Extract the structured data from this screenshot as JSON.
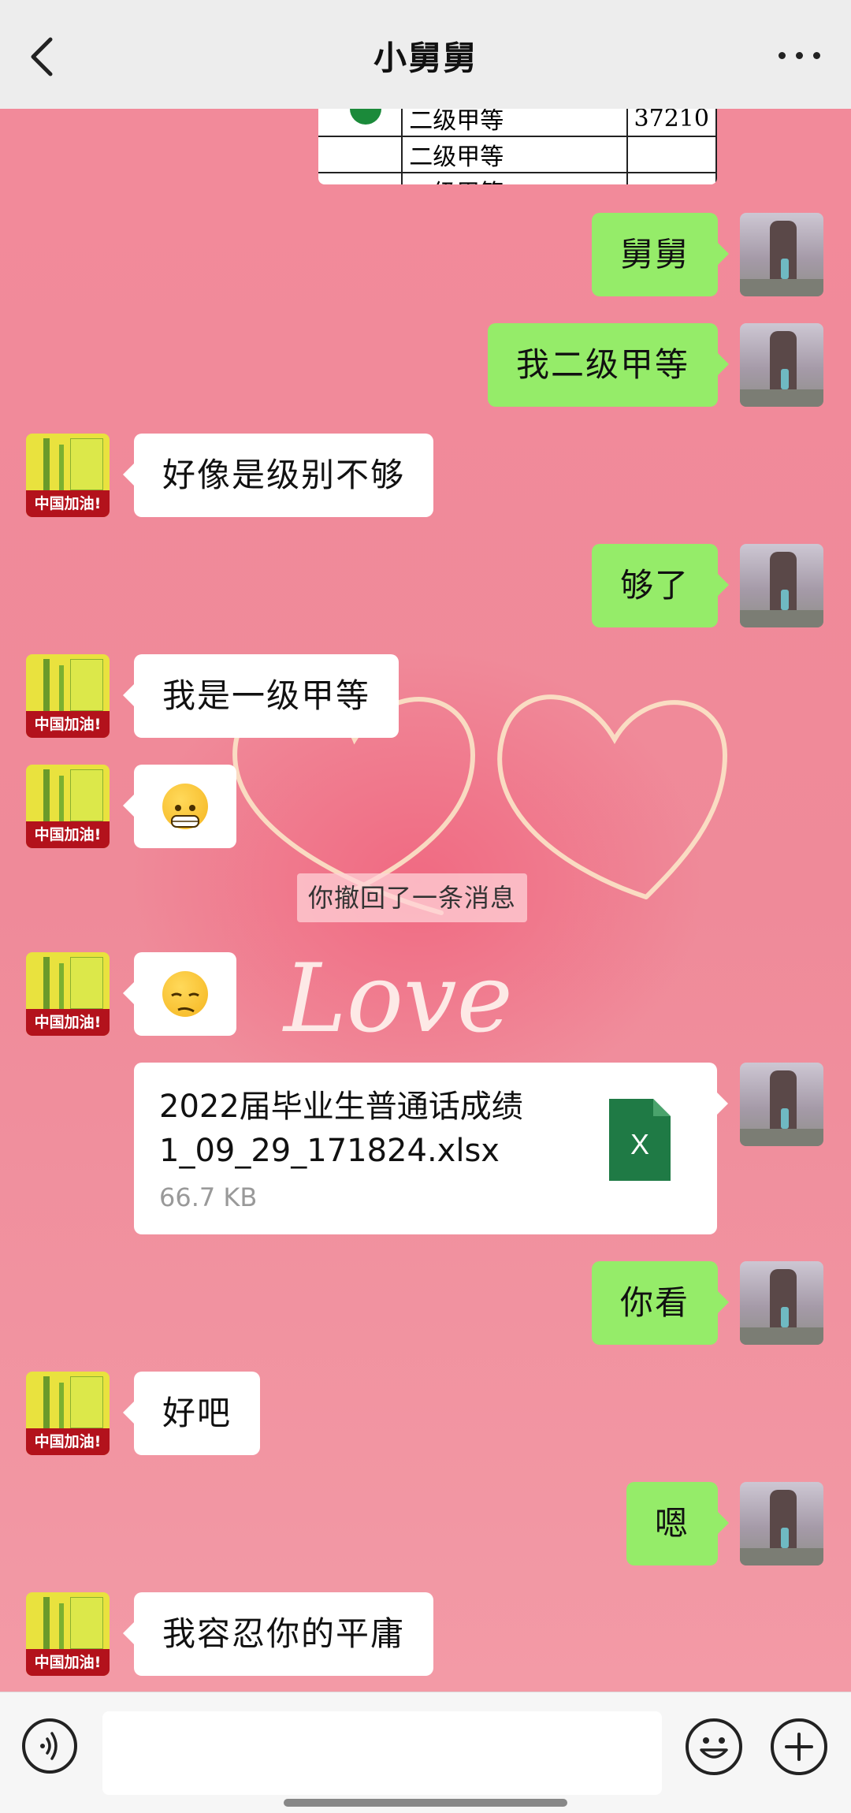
{
  "header": {
    "title": "小舅舅"
  },
  "image_table": {
    "rows": [
      [
        "二级甲等",
        "37210"
      ],
      [
        "二级甲等",
        ""
      ],
      [
        "二级甲等",
        ""
      ]
    ]
  },
  "messages": [
    {
      "side": "right",
      "text": "舅舅"
    },
    {
      "side": "right",
      "text": "我二级甲等"
    },
    {
      "side": "left",
      "text": "好像是级别不够"
    },
    {
      "side": "right",
      "text": "够了"
    },
    {
      "side": "left",
      "text": "我是一级甲等"
    },
    {
      "side": "left",
      "emoji": "grinning-face"
    },
    {
      "side": "left",
      "emoji": "smirking-face"
    },
    {
      "side": "right",
      "text": "你看"
    },
    {
      "side": "left",
      "text": "好吧"
    },
    {
      "side": "right",
      "text": "嗯"
    },
    {
      "side": "left",
      "text": "我容忍你的平庸"
    }
  ],
  "system": {
    "recall_notice": "你撤回了一条消息"
  },
  "file": {
    "name": "2022届毕业生普通话成绩1_09_29_171824.xlsx",
    "size": "66.7 KB",
    "icon": "X"
  },
  "avatar_left_banner": "中国加油!",
  "wallpaper_text": "Love",
  "colors": {
    "header_bg": "#ededed",
    "self_bubble": "#95ec69",
    "other_bubble": "#ffffff",
    "wallpaper": "#ef8a99",
    "excel_green": "#1f7a45"
  }
}
